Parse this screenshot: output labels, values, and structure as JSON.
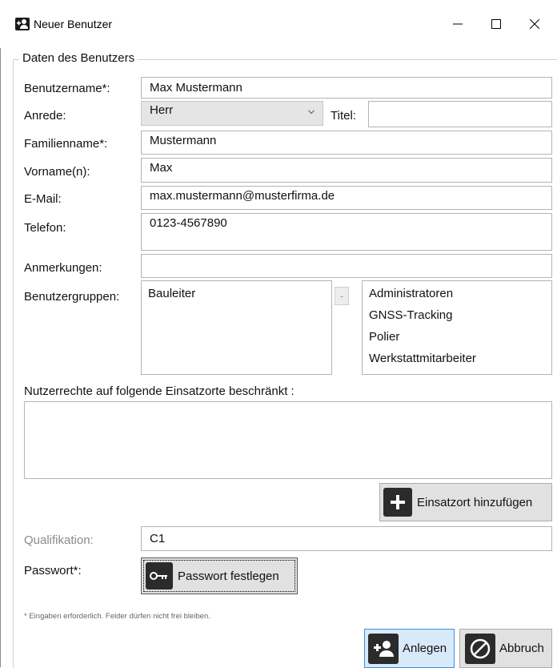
{
  "window": {
    "title": "Neuer Benutzer",
    "controls": {
      "minimize": "minimize-icon",
      "maximize": "maximize-icon",
      "close": "close-icon"
    }
  },
  "group": {
    "legend": "Daten des Benutzers"
  },
  "form": {
    "username": {
      "label": "Benutzername*:",
      "value": "Max Mustermann"
    },
    "salutation": {
      "label": "Anrede:",
      "value": "Herr"
    },
    "title": {
      "label": "Titel:",
      "value": ""
    },
    "lastname": {
      "label": "Familienname*:",
      "value": "Mustermann"
    },
    "firstname": {
      "label": "Vorname(n):",
      "value": "Max"
    },
    "email": {
      "label": "E-Mail:",
      "value": "max.mustermann@musterfirma.de"
    },
    "phone": {
      "label": "Telefon:",
      "value": "0123-4567890"
    },
    "notes": {
      "label": "Anmerkungen:",
      "value": ""
    },
    "groups": {
      "label": "Benutzergruppen:",
      "assigned": [
        "Bauleiter"
      ],
      "remove_label": "-",
      "available": [
        "Administratoren",
        "GNSS-Tracking",
        "Polier",
        "Werkstattmitarbeiter"
      ]
    },
    "locations": {
      "label": "Nutzerrechte auf folgende Einsatzorte beschränkt :",
      "add_button": "Einsatzort hinzufügen"
    },
    "qualification": {
      "label": "Qualifikation:",
      "value": "C1"
    },
    "password": {
      "label": "Passwort*:",
      "button": "Passwort festlegen"
    }
  },
  "footer": {
    "note": "* Eingaben erforderlich. Felder dürfen nicht frei bleiben.",
    "create_button": "Anlegen",
    "cancel_button": "Abbruch"
  }
}
